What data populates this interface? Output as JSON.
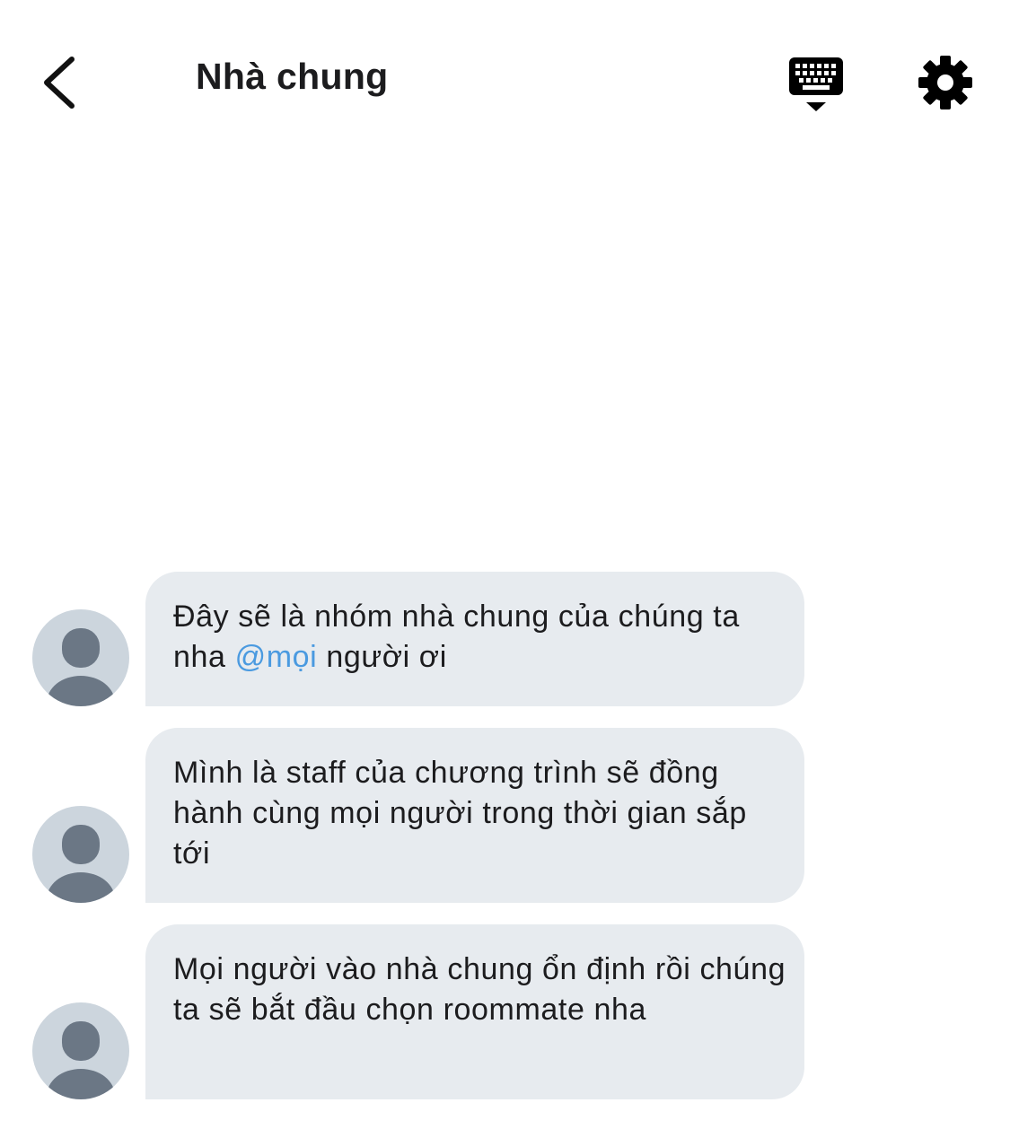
{
  "header": {
    "title": "Nhà chung",
    "back_icon": "chevron-left-icon",
    "keyboard_icon": "keyboard-hide-icon",
    "settings_icon": "gear-icon"
  },
  "messages": [
    {
      "text_before": "Đây sẽ là nhóm nhà chung của chúng ta nha ",
      "mention": "@mọi",
      "text_after": " người ơi"
    },
    {
      "text": "Mình là staff của chương trình sẽ đồng hành cùng mọi người trong thời gian sắp tới"
    },
    {
      "text": "Mọi người vào nhà chung ổn định rồi chúng ta sẽ bắt đầu chọn roommate nha"
    }
  ],
  "colors": {
    "bubble": "#e7ebef",
    "mention": "#4a9ae0",
    "avatar_bg": "#ccd5dd",
    "avatar_fg": "#6b7785"
  }
}
